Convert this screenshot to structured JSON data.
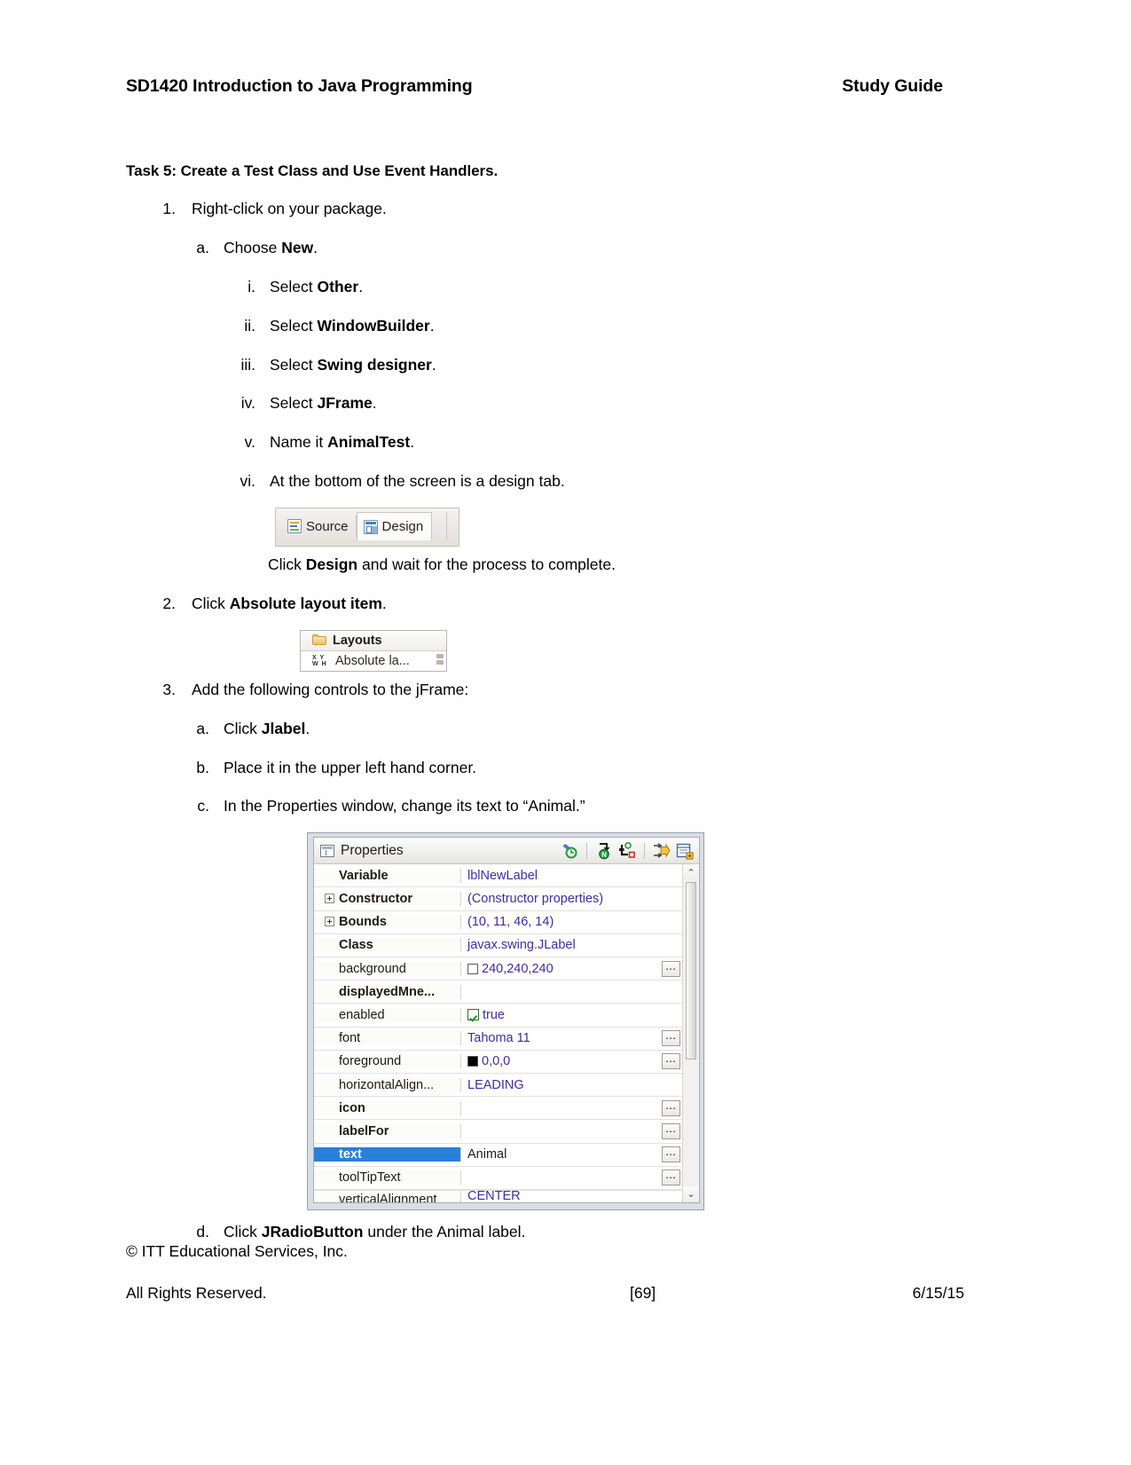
{
  "header": {
    "course_title": "SD1420 Introduction to Java Programming",
    "doc_type": "Study Guide"
  },
  "task": {
    "title": "Task 5: Create a Test Class and Use Event Handlers."
  },
  "steps": [
    {
      "marker": "1.",
      "text_before": "Right-click on your package.",
      "bold": "",
      "text_after": ""
    },
    {
      "marker": "a.",
      "text_before": "Choose ",
      "bold": "New",
      "text_after": "."
    },
    {
      "marker": "i.",
      "text_before": "Select ",
      "bold": "Other",
      "text_after": "."
    },
    {
      "marker": "ii.",
      "text_before": "Select ",
      "bold": "WindowBuilder",
      "text_after": "."
    },
    {
      "marker": "iii.",
      "text_before": "Select ",
      "bold": "Swing designer",
      "text_after": "."
    },
    {
      "marker": "iv.",
      "text_before": "Select ",
      "bold": "JFrame",
      "text_after": "."
    },
    {
      "marker": "v.",
      "text_before": "Name it ",
      "bold": "AnimalTest",
      "text_after": "."
    },
    {
      "marker": "vi.",
      "text_before": "At the bottom of the screen is a design tab.",
      "bold": "",
      "text_after": ""
    }
  ],
  "click_design": {
    "text_before": "Click ",
    "bold": "Design",
    "text_after": " and wait for the process to complete."
  },
  "step2": {
    "marker": "2.",
    "text_before": "Click ",
    "bold": "Absolute layout item",
    "text_after": "."
  },
  "step3": {
    "marker": "3.",
    "text": "Add the following controls to the jFrame:",
    "substeps": [
      {
        "marker": "a.",
        "text_before": "Click ",
        "bold": "Jlabel",
        "text_after": "."
      },
      {
        "marker": "b.",
        "text_before": "Place it in the upper left hand corner.",
        "bold": "",
        "text_after": ""
      },
      {
        "marker": "c.",
        "text_before": "In the Properties window, change its text to “Animal.”",
        "bold": "",
        "text_after": ""
      }
    ],
    "substep_d": {
      "marker": "d.",
      "text_before": "Click ",
      "bold": "JRadioButton",
      "text_after": " under the Animal label."
    }
  },
  "figure_source_design": {
    "tabs": [
      {
        "label": "Source",
        "icon": "source-file-icon",
        "active": false
      },
      {
        "label": "Design",
        "icon": "design-layout-icon",
        "active": true
      }
    ]
  },
  "figure_layouts": {
    "group_label": "Layouts",
    "group_icon": "folder-icon",
    "item_label": "Absolute la...",
    "item_icon": "xywh-icon",
    "item_icon_text_top": "X Y",
    "item_icon_text_bottom": "W H"
  },
  "figure_properties": {
    "window_title": "Properties",
    "window_icon": "properties-table-icon",
    "toolbar_icons": [
      "restore-default-value-icon",
      "show-advanced-properties-icon",
      "goto-definition-icon",
      "show-events-icon",
      "expand-all-icon"
    ],
    "rows": [
      {
        "name": "Variable",
        "value": "lblNewLabel",
        "bold": true,
        "expander": false,
        "indent": true,
        "value_type": "text",
        "ellipsis": false,
        "selected": false
      },
      {
        "name": "Constructor",
        "value": "(Constructor properties)",
        "bold": true,
        "expander": true,
        "indent": false,
        "value_type": "text",
        "ellipsis": false,
        "selected": false
      },
      {
        "name": "Bounds",
        "value": "(10, 11, 46, 14)",
        "bold": true,
        "expander": true,
        "indent": false,
        "value_type": "text",
        "ellipsis": false,
        "selected": false
      },
      {
        "name": "Class",
        "value": "javax.swing.JLabel",
        "bold": true,
        "expander": false,
        "indent": true,
        "value_type": "text",
        "ellipsis": false,
        "selected": false
      },
      {
        "name": "background",
        "value": "240,240,240",
        "bold": false,
        "expander": false,
        "indent": true,
        "value_type": "color",
        "ellipsis": true,
        "selected": false
      },
      {
        "name": "displayedMne...",
        "value": "",
        "bold": true,
        "expander": false,
        "indent": true,
        "value_type": "text",
        "ellipsis": false,
        "selected": false
      },
      {
        "name": "enabled",
        "value": "true",
        "bold": false,
        "expander": false,
        "indent": true,
        "value_type": "checkbox",
        "ellipsis": false,
        "selected": false
      },
      {
        "name": "font",
        "value": "Tahoma 11",
        "bold": false,
        "expander": false,
        "indent": true,
        "value_type": "text",
        "ellipsis": true,
        "selected": false
      },
      {
        "name": "foreground",
        "value": "0,0,0",
        "bold": false,
        "expander": false,
        "indent": true,
        "value_type": "colorblack",
        "ellipsis": true,
        "selected": false
      },
      {
        "name": "horizontalAlign...",
        "value": "LEADING",
        "bold": false,
        "expander": false,
        "indent": true,
        "value_type": "text",
        "ellipsis": false,
        "selected": false
      },
      {
        "name": "icon",
        "value": "",
        "bold": true,
        "expander": false,
        "indent": true,
        "value_type": "text",
        "ellipsis": true,
        "selected": false
      },
      {
        "name": "labelFor",
        "value": "",
        "bold": true,
        "expander": false,
        "indent": true,
        "value_type": "text",
        "ellipsis": true,
        "selected": false
      },
      {
        "name": "text",
        "value": "Animal",
        "bold": true,
        "expander": false,
        "indent": true,
        "value_type": "text",
        "ellipsis": true,
        "selected": true
      },
      {
        "name": "toolTipText",
        "value": "",
        "bold": false,
        "expander": false,
        "indent": true,
        "value_type": "text",
        "ellipsis": true,
        "selected": false
      }
    ],
    "clipped_row": {
      "name": "verticalAlignment",
      "value": "CENTER"
    },
    "scrollbar": {
      "up_arrow": "⌃",
      "down_arrow": "⌄"
    }
  },
  "footer": {
    "copyright": "© ITT Educational Services, Inc.",
    "rights": "All Rights Reserved.",
    "page_number": "[69]",
    "date": "6/15/15"
  },
  "colors": {
    "selection_blue": "#2a7fdb",
    "value_purple": "#3a2fa0",
    "text_black": "#000000"
  }
}
